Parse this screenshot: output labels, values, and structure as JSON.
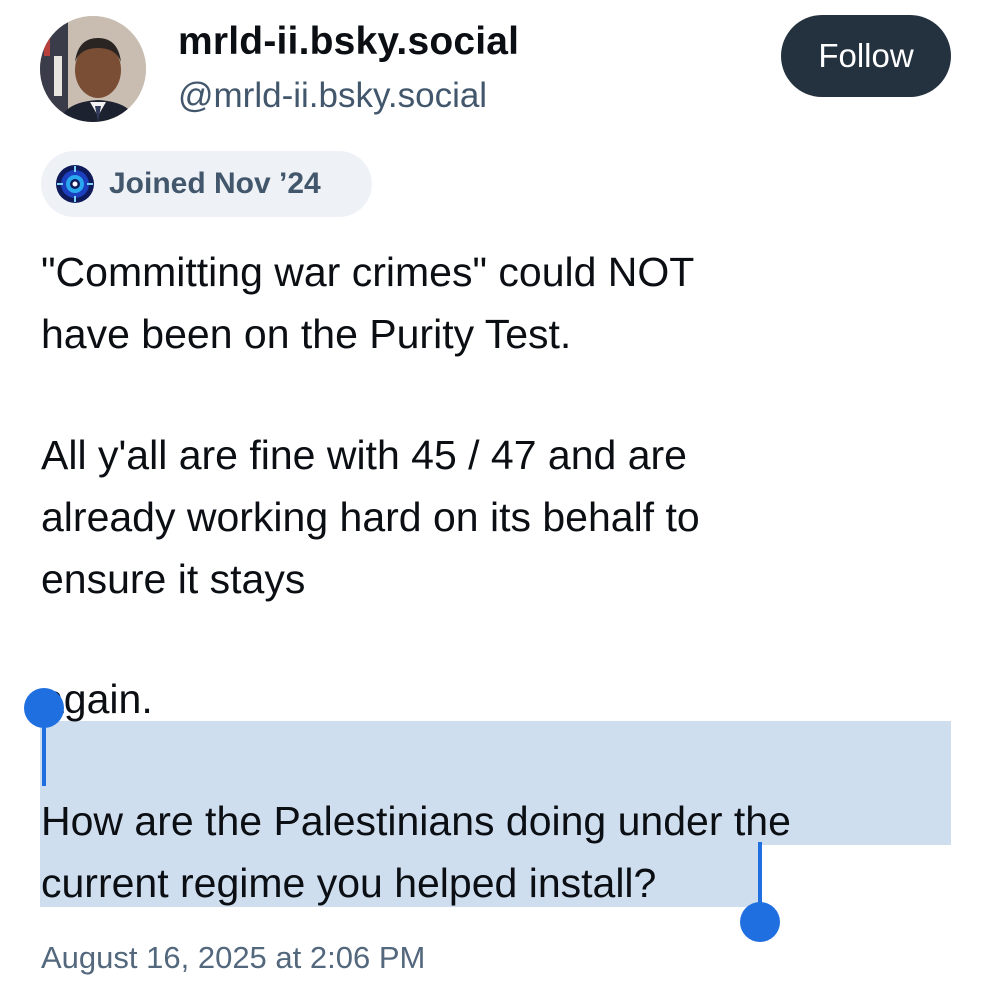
{
  "profile": {
    "display_name": "mrld-ii.bsky.social",
    "handle": "@mrld-ii.bsky.social",
    "avatar_icon": "user-avatar",
    "follow_label": "Follow",
    "joined_icon": "starter-pack-icon",
    "joined_label": "Joined Nov ’24"
  },
  "post": {
    "lines": [
      "\"Committing war crimes\" could NOT",
      "have been on the Purity Test.",
      "All y'all are fine with 45 / 47 and are",
      "already working hard on its behalf to",
      "ensure it stays",
      "again.",
      "How are the Palestinians doing under the",
      "current regime you helped install?"
    ],
    "timestamp": "August 16, 2025 at 2:06 PM"
  },
  "selection": {
    "color": "#cfdeee",
    "handle_color": "#1f6fe0"
  },
  "colors": {
    "follow_bg": "#24313f",
    "pill_bg": "#eef2f6",
    "secondary_text": "#42576c"
  }
}
